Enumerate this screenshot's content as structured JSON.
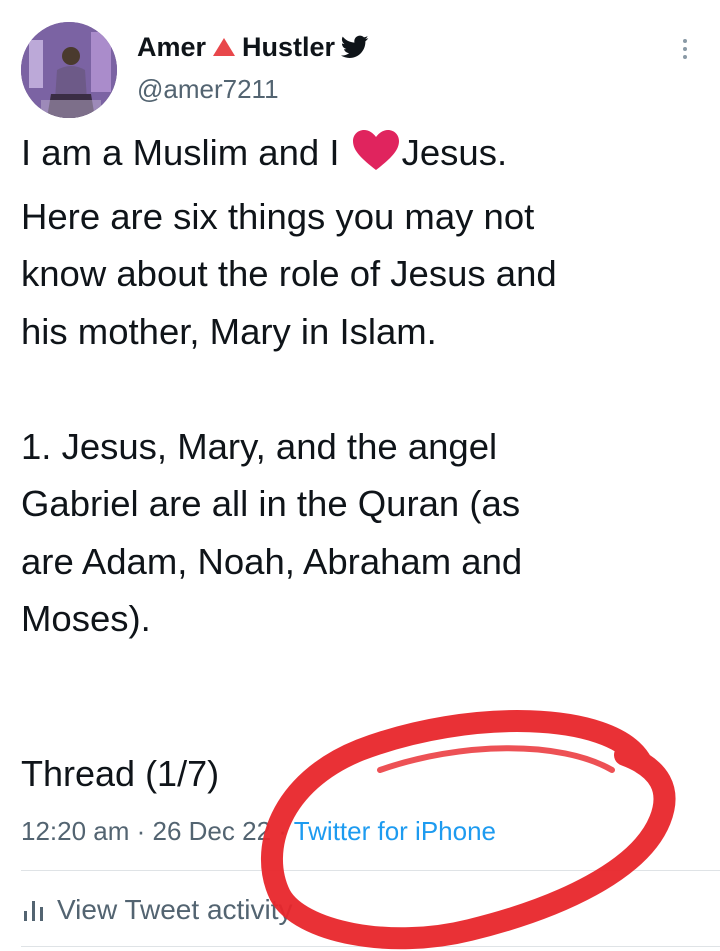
{
  "author": {
    "name_first": "Amer",
    "name_second": "Hustler",
    "handle": "@amer7211"
  },
  "tweet": {
    "line1_before_heart": "I am a Muslim and I ",
    "line1_after_heart": "Jesus.",
    "body": "\nHere are six things you may not\nknow about the role of Jesus and\nhis mother, Mary in Islam.\n\n1. Jesus, Mary, and the angel\nGabriel are all in the Quran (as\nare Adam, Noah, Abraham and\nMoses).",
    "thread_label": "Thread (1/7)"
  },
  "meta": {
    "time": "12:20 am",
    "sep1": " · ",
    "date": "26 Dec 22",
    "sep2": " · ",
    "source": "Twitter for iPhone"
  },
  "activity": {
    "label": "View Tweet activity"
  },
  "icons": {
    "verified_triangle": "red-triangle-icon",
    "bird": "twitter-bird-icon",
    "heart": "red-heart-icon",
    "more": "more-vertical-icon",
    "bars": "activity-bars-icon"
  },
  "colors": {
    "text": "#0f1419",
    "muted": "#536471",
    "link": "#1d9bf0",
    "annotation": "#e8262b",
    "heart": "#e0245e"
  }
}
